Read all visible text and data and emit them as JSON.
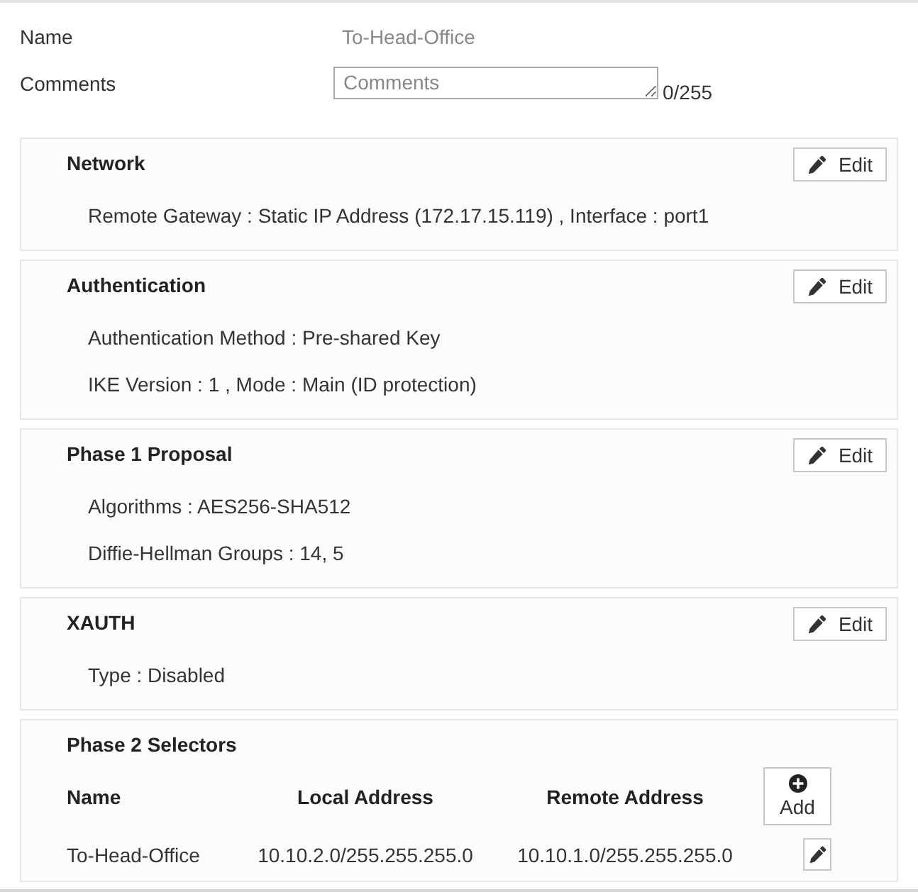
{
  "name": {
    "label": "Name",
    "value": "To-Head-Office"
  },
  "comments": {
    "label": "Comments",
    "placeholder": "Comments",
    "counter": "0/255"
  },
  "sections": [
    {
      "title": "Network",
      "button": "Edit",
      "lines": [
        "Remote Gateway : Static IP Address (172.17.15.119) , Interface : port1"
      ]
    },
    {
      "title": "Authentication",
      "button": "Edit",
      "lines": [
        "Authentication Method : Pre-shared Key",
        "IKE Version : 1 , Mode : Main (ID protection)"
      ]
    },
    {
      "title": "Phase 1 Proposal",
      "button": "Edit",
      "lines": [
        "Algorithms : AES256-SHA512",
        "Diffie-Hellman Groups : 14, 5"
      ]
    },
    {
      "title": "XAUTH",
      "button": "Edit",
      "lines": [
        "Type : Disabled"
      ]
    }
  ],
  "phase2": {
    "title": "Phase 2 Selectors",
    "columns": [
      "Name",
      "Local Address",
      "Remote Address"
    ],
    "add_button": "Add",
    "rows": [
      {
        "name": "To-Head-Office",
        "local_address": "10.10.2.0/255.255.255.0",
        "remote_address": "10.10.1.0/255.255.255.0"
      }
    ]
  }
}
